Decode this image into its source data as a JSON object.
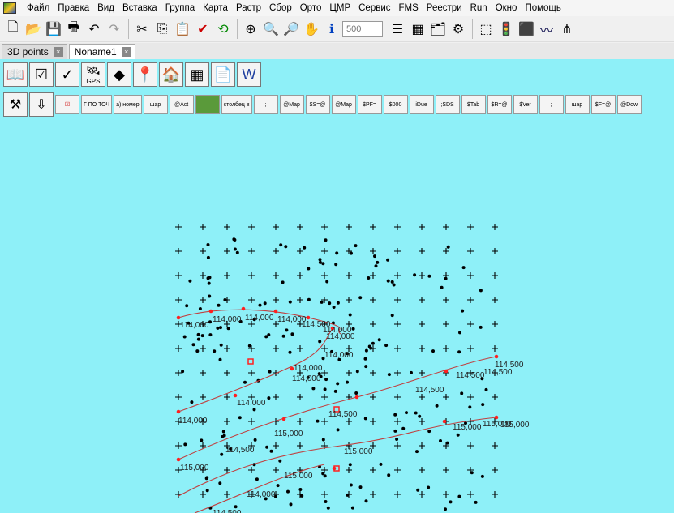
{
  "menu": [
    "Файл",
    "Правка",
    "Вид",
    "Вставка",
    "Группа",
    "Карта",
    "Растр",
    "Сбор",
    "Орто",
    "ЦМР",
    "Сервис",
    "FMS",
    "Реестри",
    "Run",
    "Окно",
    "Помощь"
  ],
  "toolbar": {
    "zoom_placeholder": "500"
  },
  "tabs": [
    "3D points",
    "Noname1"
  ],
  "toolbar2": {
    "gps_label": "GPS"
  },
  "macros": [
    "Г ПО ТОЧ",
    "а) номер",
    "шар",
    "@Act",
    "столбец в",
    ";",
    "@Map",
    "$S=@",
    "@Map",
    "$PF=",
    "$000",
    "iDue",
    ";SDS",
    "$Tab",
    "$R=@",
    "$Ver",
    ";",
    "шар",
    "$F=@",
    "@Dow"
  ],
  "contour_labels": [
    "114,000",
    "114,000",
    "114,000",
    "114,000",
    "114,500",
    "114,000",
    "114,000",
    "114,000",
    "114,000",
    "114,000",
    "114,000",
    "114,500",
    "114,500",
    "114,500",
    "114,500",
    "114,500",
    "115,000",
    "115,000",
    "115,000",
    "115,000",
    "115,000",
    "114,000",
    "114,500",
    "115,000"
  ],
  "colors": {
    "background": "#8ef0f8",
    "contour": "#c04040",
    "marker": "#ff2020"
  }
}
